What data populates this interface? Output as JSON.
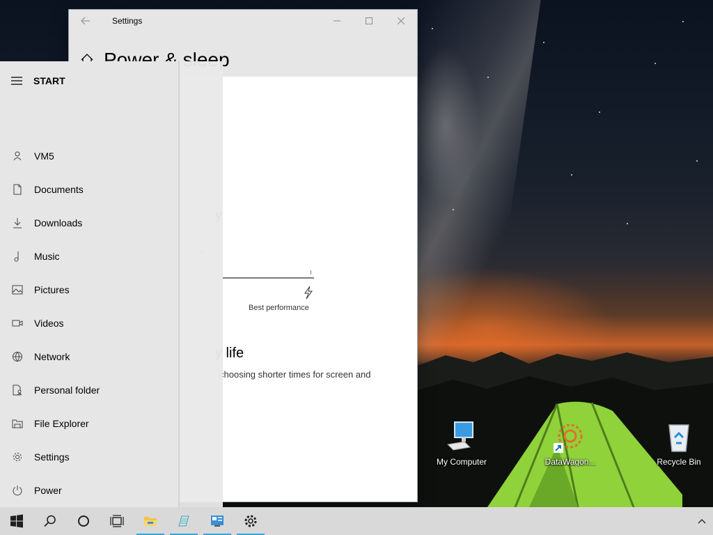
{
  "settings_window": {
    "title": "Settings",
    "page_title": "Power & sleep",
    "power_mode_heading_fragment": "y",
    "slider_right_label": "Best performance",
    "battery_heading_fragment": "y life",
    "battery_desc_fragment": "choosing shorter times for screen and"
  },
  "start_menu": {
    "header_label": "START",
    "items": [
      {
        "label": "VM5",
        "icon": "user-icon"
      },
      {
        "label": "Documents",
        "icon": "document-icon"
      },
      {
        "label": "Downloads",
        "icon": "download-icon"
      },
      {
        "label": "Music",
        "icon": "music-icon"
      },
      {
        "label": "Pictures",
        "icon": "pictures-icon"
      },
      {
        "label": "Videos",
        "icon": "video-icon"
      },
      {
        "label": "Network",
        "icon": "network-icon"
      },
      {
        "label": "Personal folder",
        "icon": "personal-folder-icon"
      },
      {
        "label": "File Explorer",
        "icon": "file-explorer-icon"
      },
      {
        "label": "Settings",
        "icon": "gear-icon"
      },
      {
        "label": "Power",
        "icon": "power-icon"
      }
    ]
  },
  "desktop_icons": [
    {
      "label": "My Computer",
      "icon": "computer-icon"
    },
    {
      "label": "DataWagon...",
      "icon": "datawagon-icon"
    },
    {
      "label": "Recycle Bin",
      "icon": "recycle-bin-icon"
    }
  ],
  "taskbar": {
    "items": [
      "windows-start-icon",
      "search-icon",
      "cortana-icon",
      "task-view-icon",
      "file-explorer-icon",
      "notepad-icon",
      "control-panel-icon",
      "gear-icon"
    ],
    "accent_color": "#3ea0d6"
  }
}
